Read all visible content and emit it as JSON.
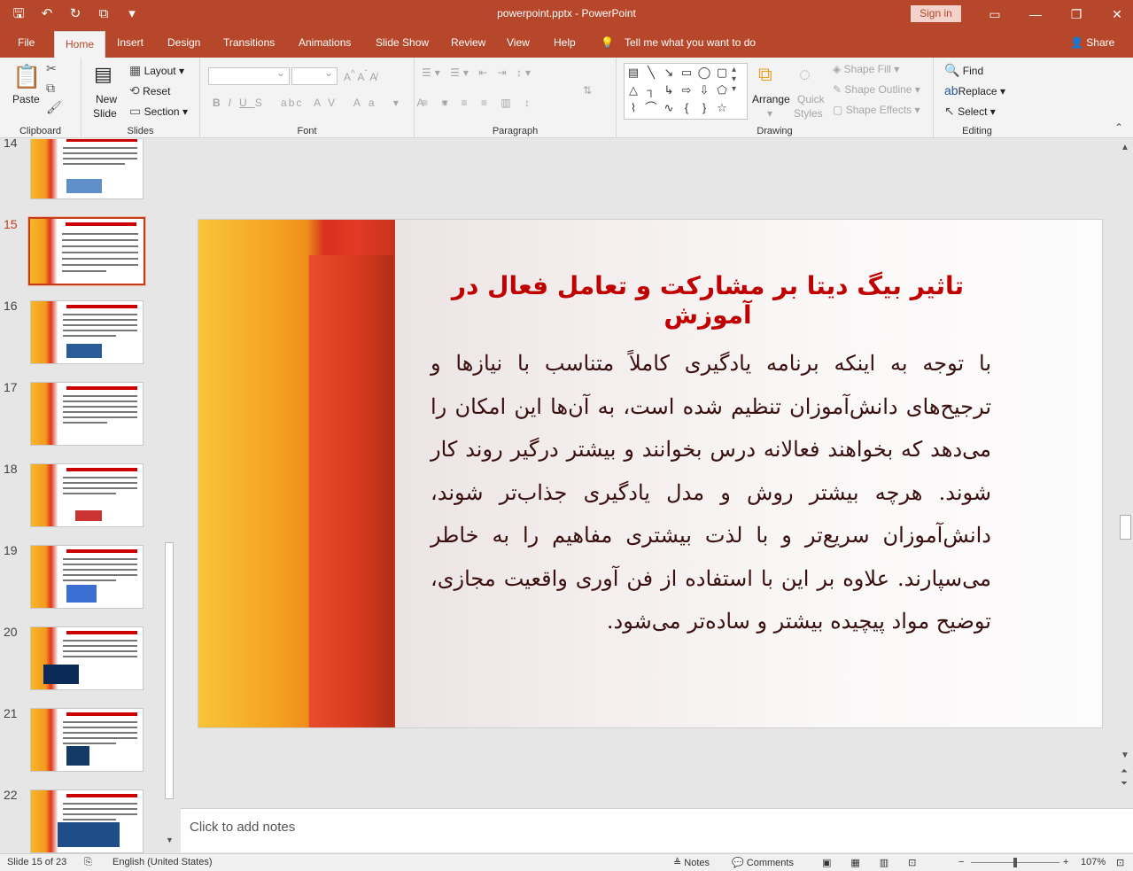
{
  "window": {
    "title": "powerpoint.pptx  -  PowerPoint",
    "signin_label": "Sign in"
  },
  "tabs": {
    "file": "File",
    "home": "Home",
    "insert": "Insert",
    "design": "Design",
    "transitions": "Transitions",
    "animations": "Animations",
    "slideshow": "Slide Show",
    "review": "Review",
    "view": "View",
    "help": "Help",
    "tellme": "Tell me what you want to do",
    "share": "Share"
  },
  "ribbon": {
    "clipboard": {
      "label": "Clipboard",
      "paste": "Paste"
    },
    "slides": {
      "label": "Slides",
      "new_slide": "New",
      "new_slide2": "Slide",
      "layout": "Layout",
      "reset": "Reset",
      "section": "Section"
    },
    "font": {
      "label": "Font"
    },
    "paragraph": {
      "label": "Paragraph"
    },
    "drawing": {
      "label": "Drawing",
      "arrange": "Arrange",
      "quick_styles1": "Quick",
      "quick_styles2": "Styles",
      "shape_fill": "Shape Fill",
      "shape_outline": "Shape Outline",
      "shape_effects": "Shape Effects"
    },
    "editing": {
      "label": "Editing",
      "find": "Find",
      "replace": "Replace",
      "select": "Select"
    }
  },
  "thumbnails": [
    {
      "num": "14"
    },
    {
      "num": "15",
      "active": true
    },
    {
      "num": "16"
    },
    {
      "num": "17"
    },
    {
      "num": "18"
    },
    {
      "num": "19"
    },
    {
      "num": "20"
    },
    {
      "num": "21"
    },
    {
      "num": "22"
    }
  ],
  "slide": {
    "title": "تاثیر بیگ دیتا بر مشارکت و تعامل فعال در آموزش",
    "body": "با توجه به اینکه برنامه یادگیری کاملاً متناسب با نیازها و ترجیح‌های دانش‌آموزان تنظیم شده است، به آن‌ها این امکان را می‌دهد که بخواهند فعالانه درس بخوانند و بیشتر درگیر روند کار شوند. هرچه بیشتر روش و مدل یادگیری جذاب‌تر شوند، دانش‌آموزان سریع‌تر و با لذت بیشتری مفاهیم را به خاطر می‌سپارند. علاوه بر این با استفاده از فن آوری واقعیت مجازی، توضیح مواد پیچیده بیشتر و ساده‌تر می‌شود."
  },
  "notes": {
    "placeholder": "Click to add notes"
  },
  "status": {
    "slide_info": "Slide 15 of 23",
    "language": "English (United States)",
    "notes": "Notes",
    "comments": "Comments",
    "zoom": "107%"
  }
}
